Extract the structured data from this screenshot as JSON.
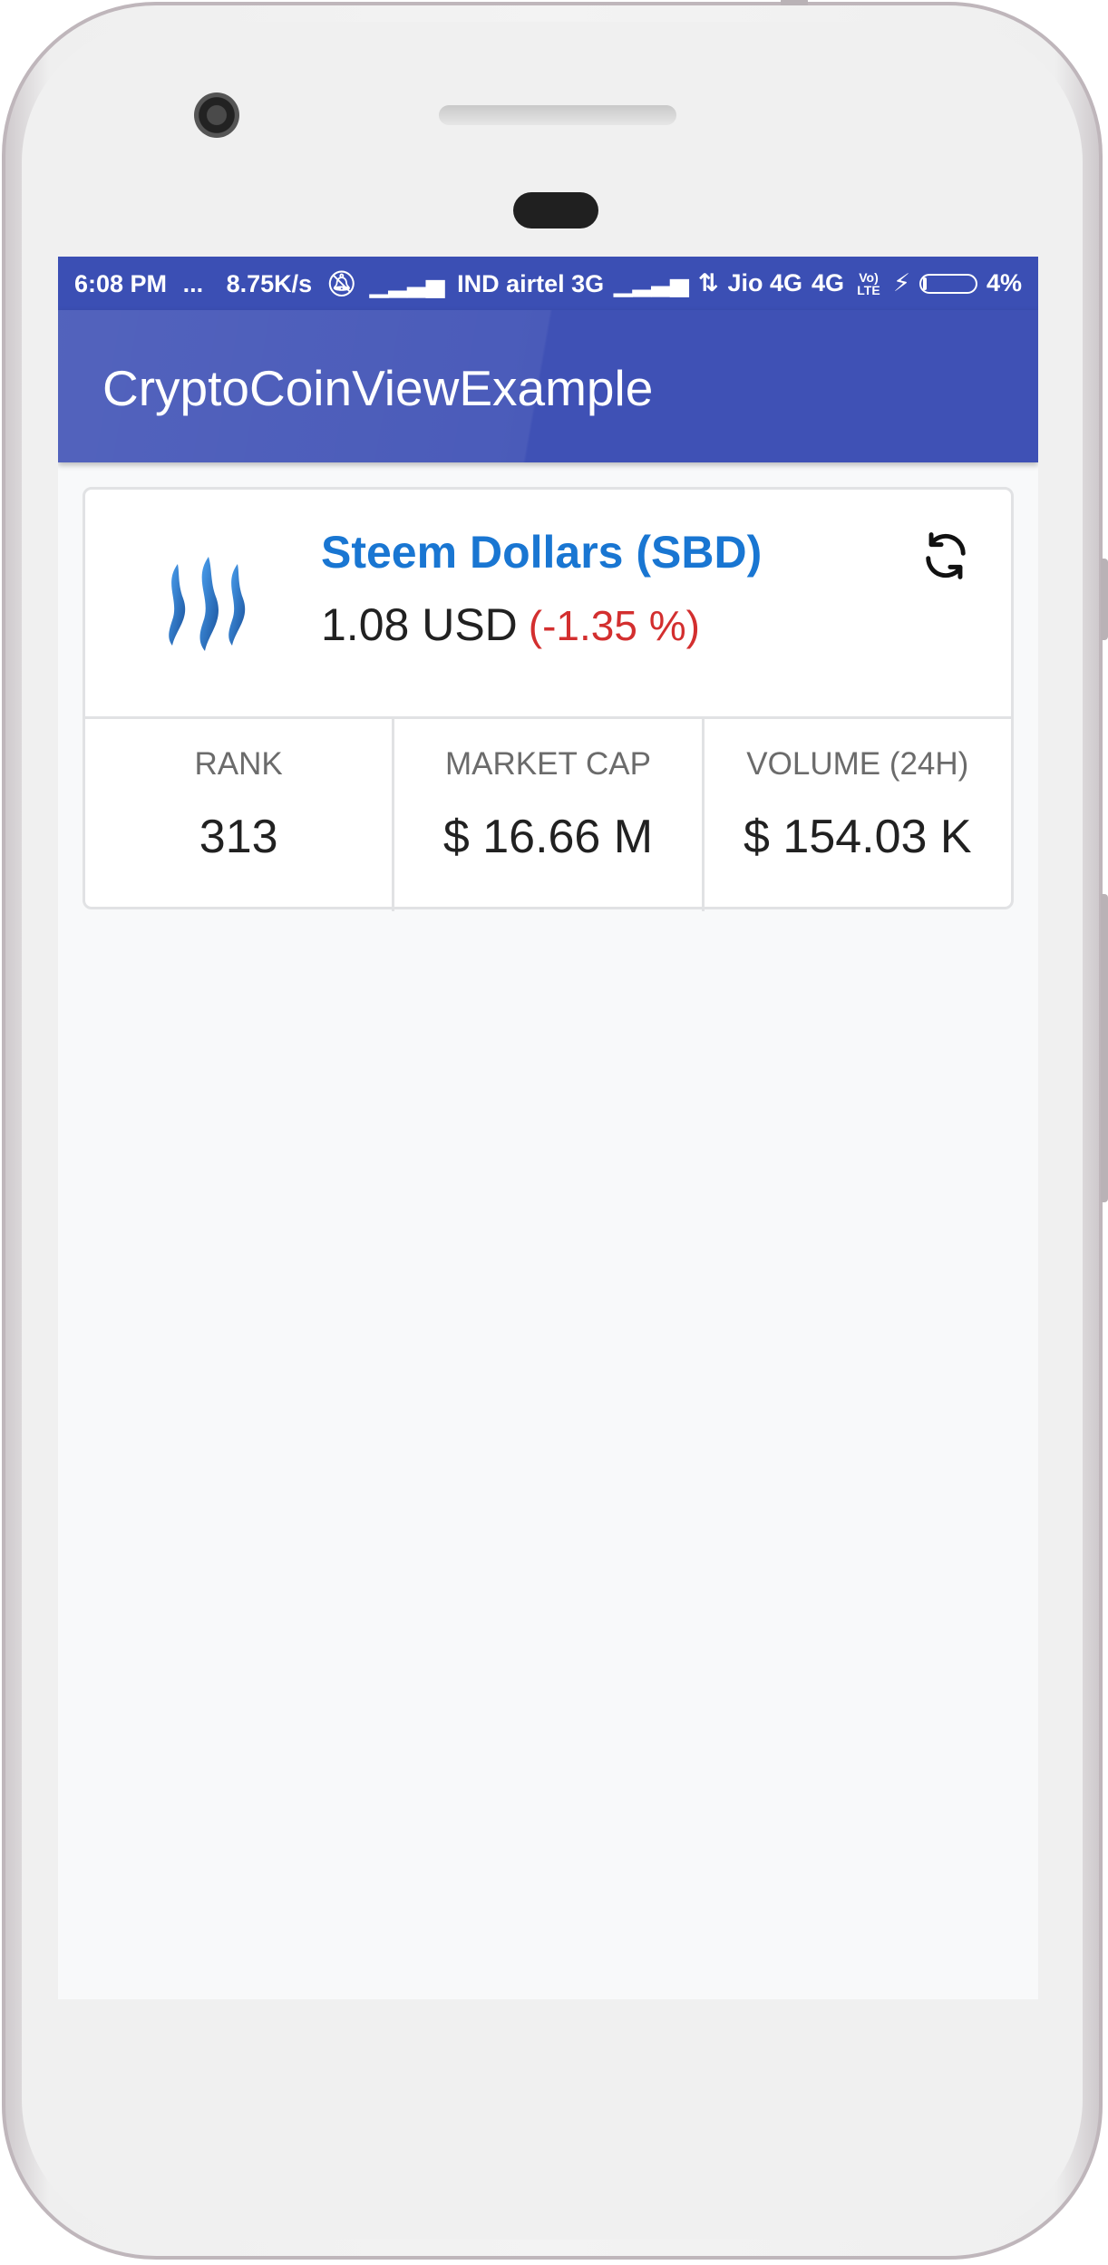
{
  "status_bar": {
    "time": "6:08 PM",
    "more": "...",
    "speed": "8.75K/s",
    "carrier1": "IND airtel 3G",
    "carrier2": "Jio 4G",
    "network": "4G",
    "volte": "Vo) LTE",
    "battery": "4%",
    "battery_level": 0.04
  },
  "app_bar": {
    "title": "CryptoCoinViewExample"
  },
  "coin": {
    "name": "Steem Dollars (SBD)",
    "price": "1.08 USD",
    "change": "(-1.35 %)",
    "logo_icon": "steem-logo",
    "refresh_icon": "refresh-icon"
  },
  "stats": [
    {
      "label": "RANK",
      "value": "313"
    },
    {
      "label": "MARKET CAP",
      "value": "$ 16.66 M"
    },
    {
      "label": "VOLUME (24H)",
      "value": "$ 154.03 K"
    }
  ],
  "colors": {
    "primary": "#3f51b5",
    "primary_dark": "#3b4fb4",
    "coin_name": "#1976d2",
    "negative_change": "#d32f2f"
  }
}
